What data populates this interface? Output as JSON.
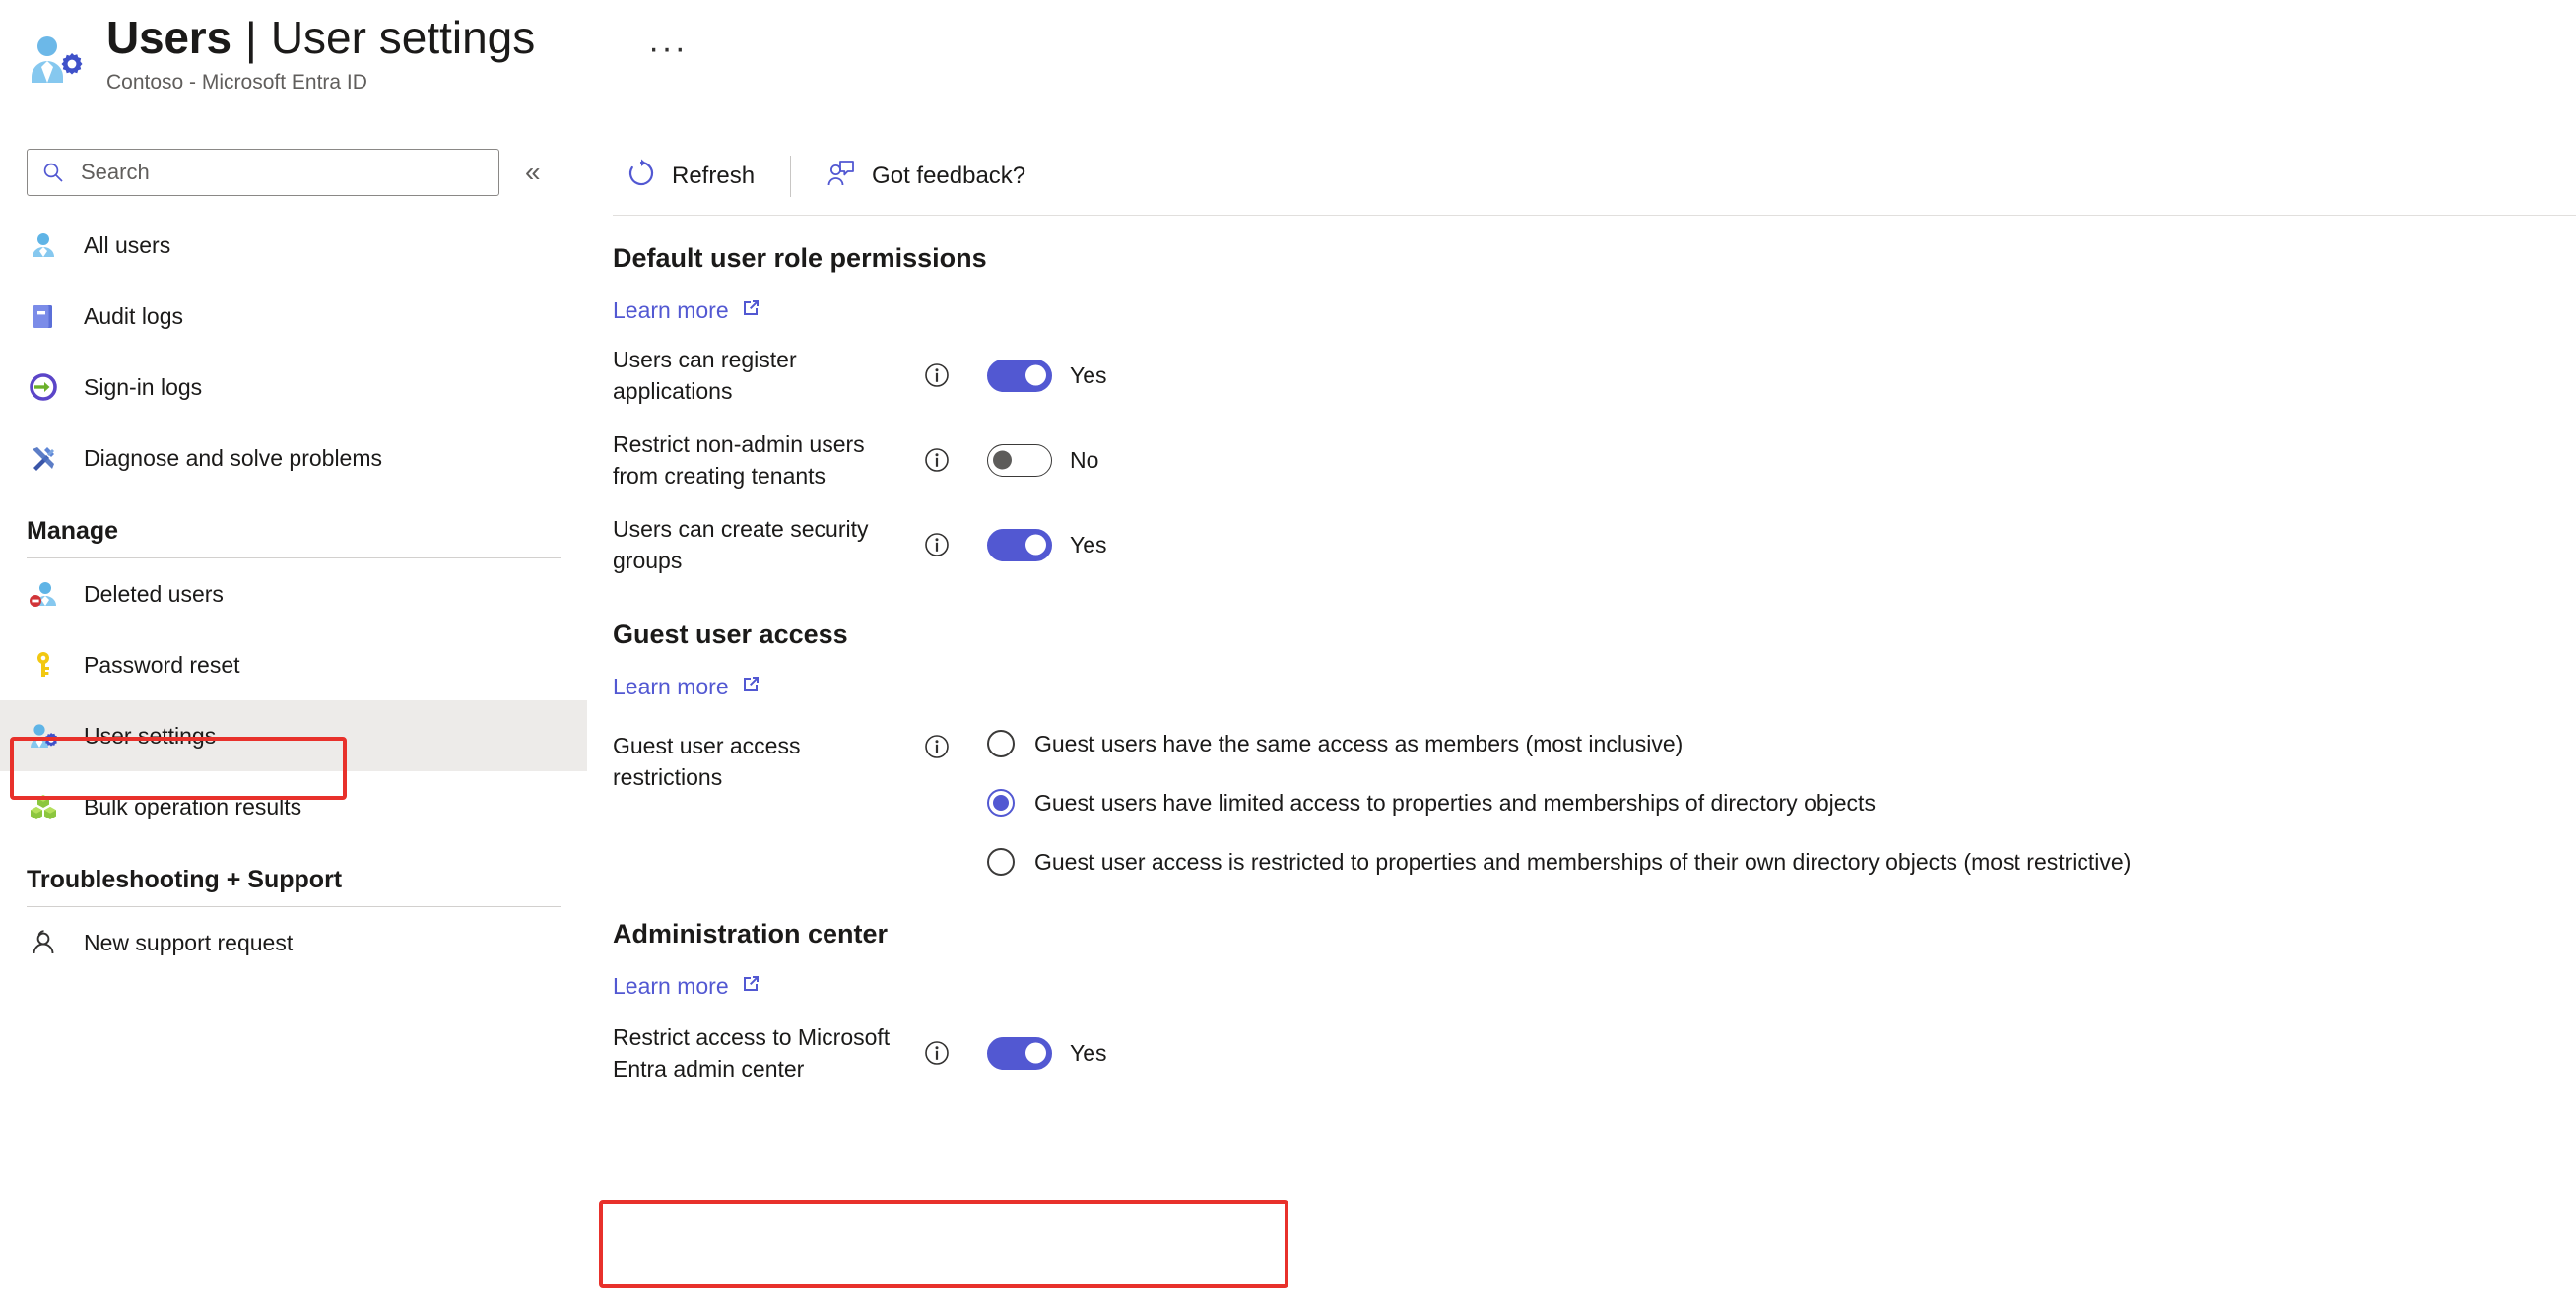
{
  "header": {
    "title_main": "Users",
    "title_separator": "|",
    "title_sub": "User settings",
    "subtitle": "Contoso - Microsoft Entra ID",
    "more_label": "···",
    "icon": "users-settings-icon"
  },
  "sidebar": {
    "search": {
      "placeholder": "Search",
      "value": "",
      "icon": "search-icon"
    },
    "collapse_label": "«",
    "top_items": [
      {
        "label": "All users",
        "icon": "user-icon"
      },
      {
        "label": "Audit logs",
        "icon": "book-icon"
      },
      {
        "label": "Sign-in logs",
        "icon": "sign-in-icon"
      },
      {
        "label": "Diagnose and solve problems",
        "icon": "tools-icon"
      }
    ],
    "groups": [
      {
        "title": "Manage",
        "items": [
          {
            "label": "Deleted users",
            "icon": "deleted-user-icon",
            "selected": false
          },
          {
            "label": "Password reset",
            "icon": "key-icon",
            "selected": false
          },
          {
            "label": "User settings",
            "icon": "users-settings-icon",
            "selected": true
          },
          {
            "label": "Bulk operation results",
            "icon": "cubes-icon",
            "selected": false
          }
        ]
      },
      {
        "title": "Troubleshooting + Support",
        "items": [
          {
            "label": "New support request",
            "icon": "support-person-icon",
            "selected": false
          }
        ]
      }
    ]
  },
  "toolbar": {
    "refresh_label": "Refresh",
    "refresh_icon": "refresh-icon",
    "feedback_label": "Got feedback?",
    "feedback_icon": "feedback-person-icon"
  },
  "main": {
    "sections": {
      "default_permissions": {
        "title": "Default user role permissions",
        "learn_more": "Learn more",
        "settings": [
          {
            "label": "Users can register applications",
            "state_label": "Yes",
            "state": "on"
          },
          {
            "label": "Restrict non-admin users from creating tenants",
            "state_label": "No",
            "state": "off"
          },
          {
            "label": "Users can create security groups",
            "state_label": "Yes",
            "state": "on"
          }
        ]
      },
      "guest_user_access": {
        "title": "Guest user access",
        "learn_more": "Learn more",
        "restrictions_label": "Guest user access restrictions",
        "options": [
          {
            "label": "Guest users have the same access as members (most inclusive)",
            "checked": false
          },
          {
            "label": "Guest users have limited access to properties and memberships of directory objects",
            "checked": true
          },
          {
            "label": "Guest user access is restricted to properties and memberships of their own directory objects (most restrictive)",
            "checked": false
          }
        ]
      },
      "administration_center": {
        "title": "Administration center",
        "learn_more": "Learn more",
        "settings": [
          {
            "label": "Restrict access to Microsoft Entra admin center",
            "state_label": "Yes",
            "state": "on"
          }
        ]
      }
    }
  },
  "colors": {
    "accent_blue": "#5258d2",
    "link_blue": "#5258d2",
    "annotation_red": "#e8312b",
    "selected_bg": "#edebe9",
    "toggle_off_gray": "#5d5c5a"
  }
}
